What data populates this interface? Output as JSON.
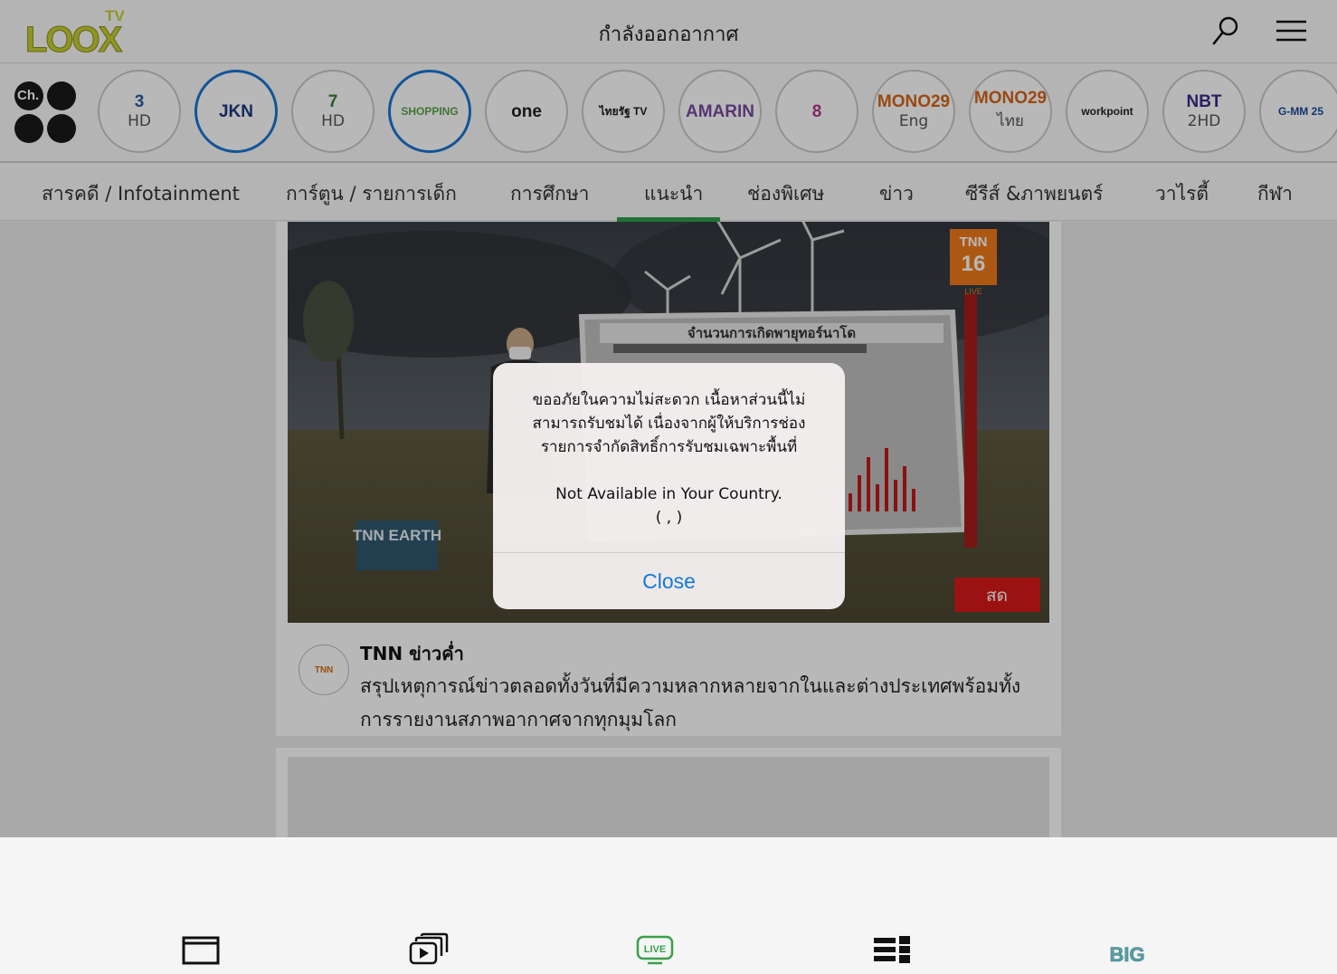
{
  "header": {
    "logo_text": "LOOX",
    "logo_superscript": "TV",
    "title": "กำลังออกอากาศ",
    "search_icon": "search-icon",
    "menu_icon": "hamburger-menu-icon"
  },
  "channels": {
    "all_label": "Ch.",
    "items": [
      {
        "main": "3",
        "sub": "HD",
        "color": "#2c5aa0"
      },
      {
        "main": "JKN",
        "sub": "",
        "color": "#1a3a7a"
      },
      {
        "main": "7",
        "sub": "HD",
        "color": "#3a7a3a"
      },
      {
        "main": "SHOPPING",
        "sub": "",
        "color": "#5aa04a"
      },
      {
        "main": "one",
        "sub": "",
        "color": "#222222"
      },
      {
        "main": "ไทยรัฐ TV",
        "sub": "",
        "color": "#1a1a1a"
      },
      {
        "main": "AMARIN",
        "sub": "",
        "color": "#7a4aa0"
      },
      {
        "main": "8",
        "sub": "",
        "color": "#b03a8a"
      },
      {
        "main": "MONO29",
        "sub": "Eng",
        "color": "#d4661a"
      },
      {
        "main": "MONO29",
        "sub": "ไทย",
        "color": "#d4661a"
      },
      {
        "main": "workpoint",
        "sub": "",
        "color": "#222222"
      },
      {
        "main": "NBT",
        "sub": "2HD",
        "color": "#3a2a8a"
      },
      {
        "main": "G-MM 25",
        "sub": "",
        "color": "#1a4a9a"
      }
    ]
  },
  "categories": {
    "items": [
      "สารคดี / Infotainment",
      "การ์ตูน / รายการเด็ก",
      "การศึกษา",
      "แนะนำ",
      "ช่องพิเศษ",
      "ข่าว",
      "ซีรีส์ &ภาพยนตร์",
      "วาไรตี้",
      "กีฬา"
    ],
    "active": "แนะนำ"
  },
  "player": {
    "badge_channel": "TNN",
    "badge_number": "16",
    "badge_live": "LIVE",
    "watermark": "TNN EARTH",
    "graphic_title": "จำนวนการเกิดพายุทอร์นาโด",
    "live_label": "สด"
  },
  "program": {
    "logo_text": "TNN",
    "title": "TNN ข่าวค่ำ",
    "description": "สรุปเหตุการณ์ข่าวตลอดทั้งวันที่มีความหลากหลายจากในและต่างประเทศพร้อมทั้ง การรายงานสภาพอากาศจากทุกมุมโลก"
  },
  "alert": {
    "message": "ขออภัยในความไม่สะดวก เนื้อหาส่วนนี้ไม่สามารถรับชมได้ เนื่องจากผู้ให้บริการช่องรายการจำกัดสิทธิ์การรับชมเฉพาะพื้นที่",
    "sub_line1": "Not Available in Your Country.",
    "sub_line2": "( , )",
    "close_label": "Close"
  },
  "bottom_nav": {
    "items": [
      {
        "icon": "window-icon"
      },
      {
        "icon": "video-playlist-icon"
      },
      {
        "icon": "live-tv-icon",
        "label": "LIVE",
        "color": "#3aa04a"
      },
      {
        "icon": "list-grid-icon"
      },
      {
        "icon": "big-icon",
        "label": "BIG",
        "color": "#5aa0a8"
      }
    ]
  }
}
